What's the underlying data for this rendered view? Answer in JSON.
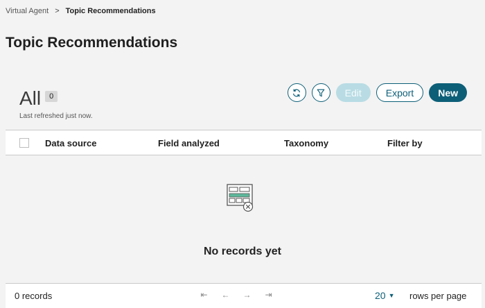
{
  "breadcrumb": {
    "parent": "Virtual Agent",
    "separator": ">",
    "current": "Topic Recommendations"
  },
  "page": {
    "title": "Topic Recommendations"
  },
  "list": {
    "title": "All",
    "count": "0",
    "last_refreshed": "Last refreshed just now."
  },
  "toolbar": {
    "refresh_icon": "refresh-icon",
    "filter_icon": "filter-icon",
    "edit_label": "Edit",
    "export_label": "Export",
    "new_label": "New"
  },
  "table": {
    "columns": [
      "Data source",
      "Field analyzed",
      "Taxonomy",
      "Filter by"
    ],
    "empty_icon": "empty-records-icon",
    "empty_message": "No records yet"
  },
  "footer": {
    "records_label": "0 records",
    "pager": {
      "first": "⇤",
      "prev": "←",
      "next": "→",
      "last": "⇥"
    },
    "rows_per_page_value": "20",
    "rows_per_page_label": "rows per page"
  },
  "colors": {
    "accent": "#0d5f78",
    "disabled": "#b9dce4",
    "background": "#f3f3f3"
  }
}
